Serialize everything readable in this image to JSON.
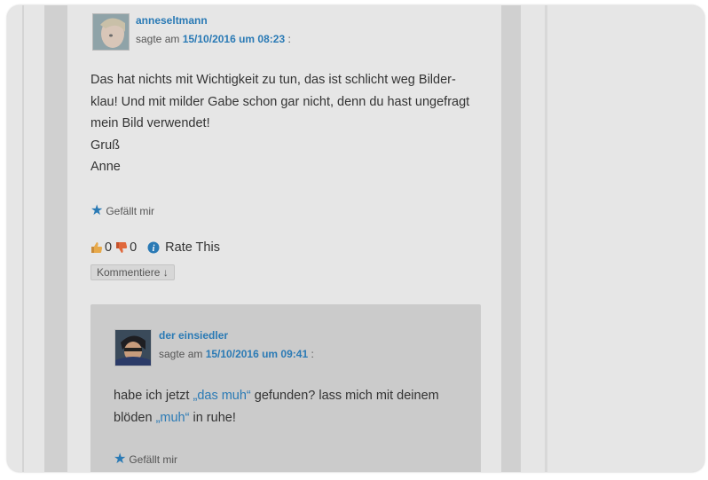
{
  "comment1": {
    "author": "anneseltmann",
    "says": "sagte am",
    "date": "15/10/2016 um 08:23",
    "colon": ":",
    "lines": [
      "Das hat nichts mit Wichtigkeit zu tun, das ist schlicht weg Bilder-",
      "klau! Und mit milder Gabe schon gar nicht, denn du hast ungefragt",
      "mein Bild verwendet!",
      "Gruß",
      "Anne"
    ],
    "like_label": "Gefällt mir",
    "thumbs_up_count": "0",
    "thumbs_down_count": "0",
    "rate_label": "Rate This",
    "reply_button": "Kommentiere ↓"
  },
  "comment2": {
    "author": "der einsiedler",
    "says": "sagte am",
    "date": "15/10/2016 um 09:41",
    "colon": ":",
    "text_before": "habe ich jetzt ",
    "link1": "„das muh“",
    "text_middle": " gefunden? lass mich mit deinem",
    "text_line2_before": "blöden ",
    "link2": "„muh“",
    "text_after": " in ruhe!",
    "like_label": "Gefällt mir"
  },
  "colors": {
    "accent": "#2a7ab5",
    "background": "#e6e6e6",
    "reply_background": "#cbcbcb"
  }
}
